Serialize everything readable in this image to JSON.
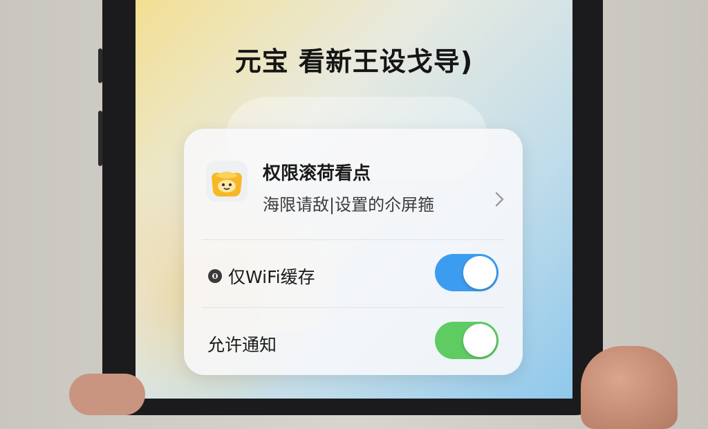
{
  "page": {
    "title": "元宝 看新王设戈导)"
  },
  "permission": {
    "title": "权限滚荷看点",
    "subtitle": "海限请敌|设置的尒屏箍",
    "icon": "gold-ingot-mascot-icon",
    "chevron_icon": "chevron-right-icon"
  },
  "settings": [
    {
      "label": "仅WiFi缓存",
      "icon": "info-icon",
      "enabled": true,
      "color": "#3c9cf0"
    },
    {
      "label": "允许通知",
      "enabled": true,
      "color": "#5ecb63"
    }
  ],
  "colors": {
    "card_bg": "#f8f8fa",
    "toggle_blue": "#3c9cf0",
    "toggle_green": "#5ecb63"
  }
}
